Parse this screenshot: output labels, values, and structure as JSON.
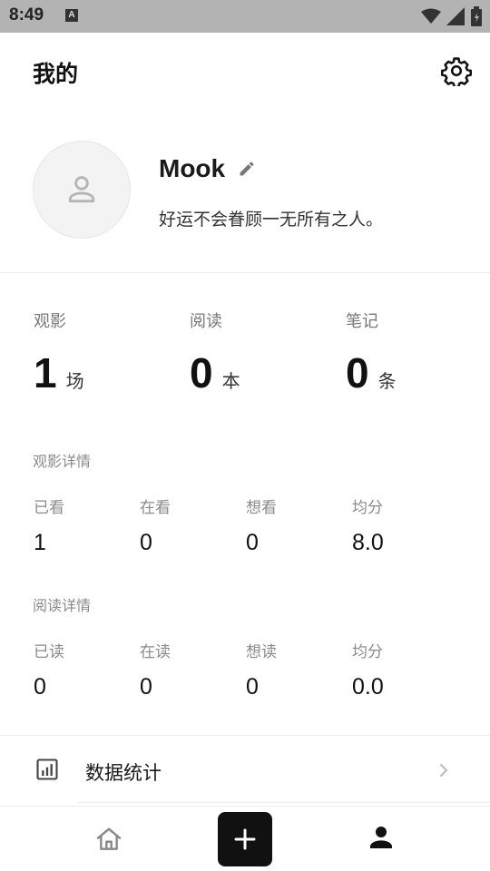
{
  "status_bar": {
    "time": "8:49",
    "notif_letter": "A"
  },
  "header": {
    "title": "我的"
  },
  "profile": {
    "username": "Mook",
    "bio": "好运不会眷顾一无所有之人。"
  },
  "stats": [
    {
      "label": "观影",
      "value": "1",
      "unit": "场"
    },
    {
      "label": "阅读",
      "value": "0",
      "unit": "本"
    },
    {
      "label": "笔记",
      "value": "0",
      "unit": "条"
    }
  ],
  "movie_details": {
    "title": "观影详情",
    "items": [
      {
        "label": "已看",
        "value": "1"
      },
      {
        "label": "在看",
        "value": "0"
      },
      {
        "label": "想看",
        "value": "0"
      },
      {
        "label": "均分",
        "value": "8.0"
      }
    ]
  },
  "reading_details": {
    "title": "阅读详情",
    "items": [
      {
        "label": "已读",
        "value": "0"
      },
      {
        "label": "在读",
        "value": "0"
      },
      {
        "label": "想读",
        "value": "0"
      },
      {
        "label": "均分",
        "value": "0.0"
      }
    ]
  },
  "menu": {
    "stats_label": "数据统计"
  },
  "icons": {
    "status": [
      "wifi-icon",
      "signal-icon",
      "battery-icon"
    ],
    "settings": "gear-icon",
    "avatar": "person-outline-icon",
    "edit": "pencil-icon",
    "menu": "bar-chart-icon",
    "nav": [
      "home-icon",
      "plus-icon",
      "person-icon"
    ]
  },
  "colors": {
    "accent": "#111111",
    "status_bar": "#b3b3b3",
    "muted_text": "#8a8a8a"
  }
}
